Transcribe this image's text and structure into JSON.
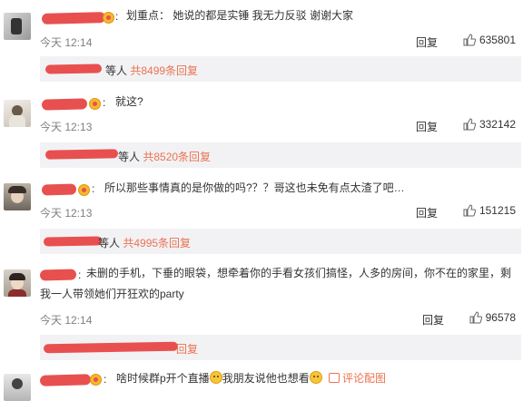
{
  "comments": [
    {
      "text": "划重点：  她说的都是实锤 我无力反驳 谢谢大家",
      "time": "今天 12:14",
      "reply_label": "回复",
      "likes": "635801",
      "thread": {
        "suffix": "等人",
        "count": "共8499条回复"
      }
    },
    {
      "text": "就这?",
      "time": "今天 12:13",
      "reply_label": "回复",
      "likes": "332142",
      "thread": {
        "suffix": "等人",
        "count": "共8520条回复"
      }
    },
    {
      "text": "所以那些事情真的是你做的吗?？？哥这也未免有点太渣了吧…",
      "time": "今天 12:13",
      "reply_label": "回复",
      "likes": "151215",
      "thread": {
        "suffix": "等人",
        "count": "共4995条回复"
      }
    },
    {
      "text": "未删的手机，下垂的眼袋，想牵着你的手看女孩们搞怪，人多的房间，你不在的家里，剩我一人带领她们开狂欢的party",
      "time": "今天 12:14",
      "reply_label": "回复",
      "likes": "96578",
      "thread": {
        "suffix": "",
        "count": "回复"
      }
    },
    {
      "text_before": "啥时候群p开个直播",
      "text_after": "我朋友说他也想看",
      "pic_label": "评论配图"
    }
  ],
  "colors": {
    "accent": "#eb7350",
    "redaction": "#e8504f",
    "sub_bg": "#f2f2f5",
    "meta_text": "#808080"
  },
  "icons": [
    "vip-crown-icon",
    "thumb-up-icon",
    "laugh-emoji-icon",
    "picture-icon"
  ]
}
